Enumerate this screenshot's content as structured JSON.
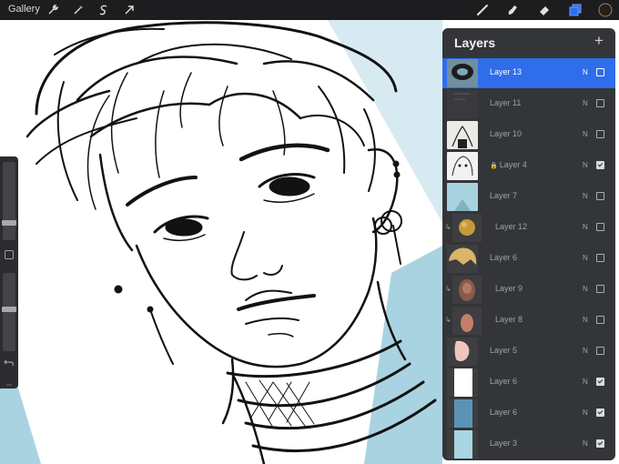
{
  "topbar": {
    "gallery_label": "Gallery",
    "left_tools": [
      {
        "name": "wrench-icon"
      },
      {
        "name": "magic-wand-icon"
      },
      {
        "name": "selection-icon"
      },
      {
        "name": "transform-arrow-icon"
      }
    ],
    "right_tools": [
      {
        "name": "brush-icon"
      },
      {
        "name": "smudge-icon"
      },
      {
        "name": "eraser-icon"
      },
      {
        "name": "layers-icon"
      },
      {
        "name": "color-swatch-icon"
      }
    ],
    "active_color": "#2a1d14",
    "accent": "#2f6dea"
  },
  "sidebar": {
    "brush_size_level": 0.7,
    "opacity_level": 0.45,
    "undo_icon": "undo-icon",
    "modify_icon": "square-modify-icon"
  },
  "layers_panel": {
    "title": "Layers",
    "add_icon": "plus-icon",
    "layers": [
      {
        "name": "Layer 13",
        "mode": "N",
        "visible": false,
        "selected": true,
        "clipped": false,
        "locked": false
      },
      {
        "name": "Layer 11",
        "mode": "N",
        "visible": false,
        "selected": false,
        "clipped": false,
        "locked": false
      },
      {
        "name": "Layer 10",
        "mode": "N",
        "visible": false,
        "selected": false,
        "clipped": false,
        "locked": false
      },
      {
        "name": "Layer 4",
        "mode": "N",
        "visible": true,
        "selected": false,
        "clipped": false,
        "locked": true
      },
      {
        "name": "Layer 7",
        "mode": "N",
        "visible": false,
        "selected": false,
        "clipped": false,
        "locked": false
      },
      {
        "name": "Layer 12",
        "mode": "N",
        "visible": false,
        "selected": false,
        "clipped": true,
        "locked": false
      },
      {
        "name": "Layer 6",
        "mode": "N",
        "visible": false,
        "selected": false,
        "clipped": false,
        "locked": false
      },
      {
        "name": "Layer 9",
        "mode": "N",
        "visible": false,
        "selected": false,
        "clipped": true,
        "locked": false
      },
      {
        "name": "Layer 8",
        "mode": "N",
        "visible": false,
        "selected": false,
        "clipped": true,
        "locked": false
      },
      {
        "name": "Layer 5",
        "mode": "N",
        "visible": false,
        "selected": false,
        "clipped": false,
        "locked": false
      },
      {
        "name": "Layer 6",
        "mode": "N",
        "visible": true,
        "selected": false,
        "clipped": false,
        "locked": false
      },
      {
        "name": "Layer 6",
        "mode": "N",
        "visible": true,
        "selected": false,
        "clipped": false,
        "locked": false
      },
      {
        "name": "Layer 3",
        "mode": "N",
        "visible": true,
        "selected": false,
        "clipped": false,
        "locked": false
      }
    ]
  }
}
